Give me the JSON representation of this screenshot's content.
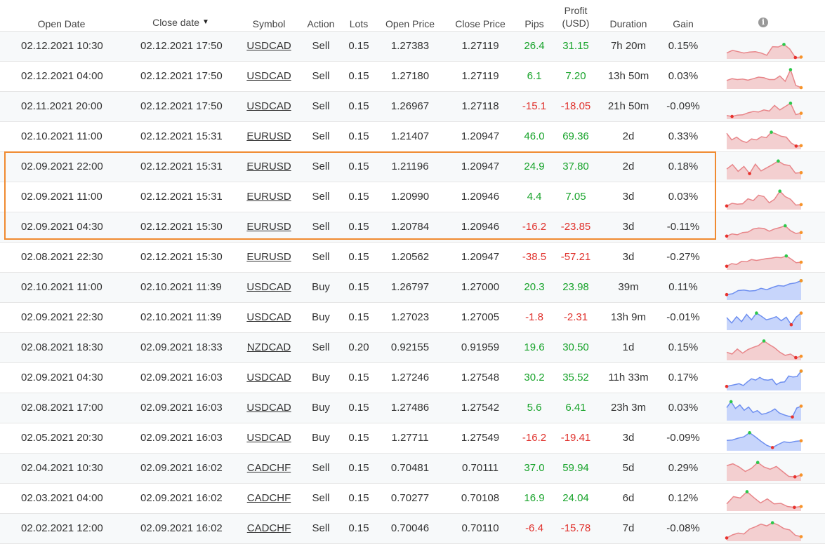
{
  "headers": {
    "open_date": "Open Date",
    "close_date": "Close date",
    "sort_arrow": "▼",
    "symbol": "Symbol",
    "action": "Action",
    "lots": "Lots",
    "open_price": "Open Price",
    "close_price": "Close Price",
    "pips": "Pips",
    "profit_line1": "Profit",
    "profit_line2": "(USD)",
    "duration": "Duration",
    "gain": "Gain",
    "info_glyph": "i"
  },
  "colors": {
    "positive": "#17a32a",
    "negative": "#e0322d",
    "highlight_border": "#f08a30",
    "spark_sell_fill": "#f3cfd0",
    "spark_sell_line": "#e8868a",
    "spark_buy_fill": "#c7d5fb",
    "spark_buy_line": "#6e8ff0",
    "spark_high_dot": "#2cc84a",
    "spark_low_dot": "#e8322d",
    "spark_end_dot": "#f7932a"
  },
  "trades": [
    {
      "open_date": "02.12.2021 10:30",
      "close_date": "02.12.2021 17:50",
      "symbol": "USDCAD",
      "action": "Sell",
      "lots": "0.15",
      "open_price": "1.27383",
      "close_price": "1.27119",
      "pips": "26.4",
      "profit": "31.15",
      "duration": "7h 20m",
      "gain": "0.15%"
    },
    {
      "open_date": "02.12.2021 04:00",
      "close_date": "02.12.2021 17:50",
      "symbol": "USDCAD",
      "action": "Sell",
      "lots": "0.15",
      "open_price": "1.27180",
      "close_price": "1.27119",
      "pips": "6.1",
      "profit": "7.20",
      "duration": "13h 50m",
      "gain": "0.03%"
    },
    {
      "open_date": "02.11.2021 20:00",
      "close_date": "02.12.2021 17:50",
      "symbol": "USDCAD",
      "action": "Sell",
      "lots": "0.15",
      "open_price": "1.26967",
      "close_price": "1.27118",
      "pips": "-15.1",
      "profit": "-18.05",
      "duration": "21h 50m",
      "gain": "-0.09%"
    },
    {
      "open_date": "02.10.2021 11:00",
      "close_date": "02.12.2021 15:31",
      "symbol": "EURUSD",
      "action": "Sell",
      "lots": "0.15",
      "open_price": "1.21407",
      "close_price": "1.20947",
      "pips": "46.0",
      "profit": "69.36",
      "duration": "2d",
      "gain": "0.33%"
    },
    {
      "open_date": "02.09.2021 22:00",
      "close_date": "02.12.2021 15:31",
      "symbol": "EURUSD",
      "action": "Sell",
      "lots": "0.15",
      "open_price": "1.21196",
      "close_price": "1.20947",
      "pips": "24.9",
      "profit": "37.80",
      "duration": "2d",
      "gain": "0.18%"
    },
    {
      "open_date": "02.09.2021 11:00",
      "close_date": "02.12.2021 15:31",
      "symbol": "EURUSD",
      "action": "Sell",
      "lots": "0.15",
      "open_price": "1.20990",
      "close_price": "1.20946",
      "pips": "4.4",
      "profit": "7.05",
      "duration": "3d",
      "gain": "0.03%"
    },
    {
      "open_date": "02.09.2021 04:30",
      "close_date": "02.12.2021 15:30",
      "symbol": "EURUSD",
      "action": "Sell",
      "lots": "0.15",
      "open_price": "1.20784",
      "close_price": "1.20946",
      "pips": "-16.2",
      "profit": "-23.85",
      "duration": "3d",
      "gain": "-0.11%"
    },
    {
      "open_date": "02.08.2021 22:30",
      "close_date": "02.12.2021 15:30",
      "symbol": "EURUSD",
      "action": "Sell",
      "lots": "0.15",
      "open_price": "1.20562",
      "close_price": "1.20947",
      "pips": "-38.5",
      "profit": "-57.21",
      "duration": "3d",
      "gain": "-0.27%"
    },
    {
      "open_date": "02.10.2021 11:00",
      "close_date": "02.10.2021 11:39",
      "symbol": "USDCAD",
      "action": "Buy",
      "lots": "0.15",
      "open_price": "1.26797",
      "close_price": "1.27000",
      "pips": "20.3",
      "profit": "23.98",
      "duration": "39m",
      "gain": "0.11%"
    },
    {
      "open_date": "02.09.2021 22:30",
      "close_date": "02.10.2021 11:39",
      "symbol": "USDCAD",
      "action": "Buy",
      "lots": "0.15",
      "open_price": "1.27023",
      "close_price": "1.27005",
      "pips": "-1.8",
      "profit": "-2.31",
      "duration": "13h 9m",
      "gain": "-0.01%"
    },
    {
      "open_date": "02.08.2021 18:30",
      "close_date": "02.09.2021 18:33",
      "symbol": "NZDCAD",
      "action": "Sell",
      "lots": "0.20",
      "open_price": "0.92155",
      "close_price": "0.91959",
      "pips": "19.6",
      "profit": "30.50",
      "duration": "1d",
      "gain": "0.15%"
    },
    {
      "open_date": "02.09.2021 04:30",
      "close_date": "02.09.2021 16:03",
      "symbol": "USDCAD",
      "action": "Buy",
      "lots": "0.15",
      "open_price": "1.27246",
      "close_price": "1.27548",
      "pips": "30.2",
      "profit": "35.52",
      "duration": "11h 33m",
      "gain": "0.17%"
    },
    {
      "open_date": "02.08.2021 17:00",
      "close_date": "02.09.2021 16:03",
      "symbol": "USDCAD",
      "action": "Buy",
      "lots": "0.15",
      "open_price": "1.27486",
      "close_price": "1.27542",
      "pips": "5.6",
      "profit": "6.41",
      "duration": "23h 3m",
      "gain": "0.03%"
    },
    {
      "open_date": "02.05.2021 20:30",
      "close_date": "02.09.2021 16:03",
      "symbol": "USDCAD",
      "action": "Buy",
      "lots": "0.15",
      "open_price": "1.27711",
      "close_price": "1.27549",
      "pips": "-16.2",
      "profit": "-19.41",
      "duration": "3d",
      "gain": "-0.09%"
    },
    {
      "open_date": "02.04.2021 10:30",
      "close_date": "02.09.2021 16:02",
      "symbol": "CADCHF",
      "action": "Sell",
      "lots": "0.15",
      "open_price": "0.70481",
      "close_price": "0.70111",
      "pips": "37.0",
      "profit": "59.94",
      "duration": "5d",
      "gain": "0.29%"
    },
    {
      "open_date": "02.03.2021 04:00",
      "close_date": "02.09.2021 16:02",
      "symbol": "CADCHF",
      "action": "Sell",
      "lots": "0.15",
      "open_price": "0.70277",
      "close_price": "0.70108",
      "pips": "16.9",
      "profit": "24.04",
      "duration": "6d",
      "gain": "0.12%"
    },
    {
      "open_date": "02.02.2021 12:00",
      "close_date": "02.09.2021 16:02",
      "symbol": "CADCHF",
      "action": "Sell",
      "lots": "0.15",
      "open_price": "0.70046",
      "close_price": "0.70110",
      "pips": "-6.4",
      "profit": "-15.78",
      "duration": "7d",
      "gain": "-0.08%"
    }
  ],
  "sparklines": [
    [
      20,
      32,
      26,
      20,
      24,
      26,
      20,
      10,
      48,
      47,
      58,
      38,
      0,
      2
    ],
    [
      32,
      40,
      36,
      38,
      33,
      40,
      47,
      44,
      36,
      36,
      52,
      28,
      80,
      10,
      0
    ],
    [
      10,
      6,
      12,
      13,
      22,
      28,
      26,
      35,
      30,
      55,
      35,
      50,
      65,
      14,
      20
    ],
    [
      65,
      36,
      48,
      32,
      24,
      40,
      36,
      50,
      46,
      70,
      62,
      52,
      48,
      22,
      8,
      10
    ],
    [
      40,
      60,
      30,
      52,
      20,
      62,
      32,
      46,
      60,
      76,
      60,
      56,
      22,
      24
    ],
    [
      10,
      22,
      18,
      20,
      42,
      34,
      58,
      52,
      24,
      40,
      76,
      52,
      40,
      14,
      16
    ],
    [
      10,
      20,
      16,
      26,
      28,
      42,
      46,
      44,
      32,
      42,
      48,
      56,
      34,
      22,
      26
    ],
    [
      10,
      22,
      18,
      32,
      30,
      40,
      36,
      40,
      44,
      46,
      50,
      48,
      56,
      42,
      26,
      28
    ],
    [
      18,
      22,
      36,
      38,
      34,
      36,
      46,
      40,
      50,
      58,
      56,
      66,
      70,
      80
    ],
    [
      50,
      26,
      54,
      32,
      64,
      40,
      70,
      56,
      40,
      46,
      54,
      36,
      52,
      18,
      52,
      70
    ],
    [
      30,
      22,
      44,
      26,
      42,
      52,
      60,
      80,
      64,
      50,
      30,
      16,
      22,
      6,
      12
    ],
    [
      12,
      16,
      20,
      24,
      16,
      32,
      46,
      40,
      52,
      42,
      40,
      44,
      20,
      30,
      32,
      58,
      54,
      56,
      80
    ],
    [
      52,
      78,
      48,
      64,
      40,
      54,
      30,
      38,
      22,
      26,
      34,
      46,
      28,
      20,
      14,
      10,
      50,
      58
    ],
    [
      40,
      42,
      50,
      56,
      74,
      56,
      36,
      18,
      8,
      22,
      34,
      30,
      36,
      38
    ],
    [
      62,
      70,
      56,
      36,
      50,
      76,
      56,
      46,
      58,
      36,
      14,
      12,
      20
    ],
    [
      26,
      58,
      52,
      80,
      54,
      30,
      48,
      26,
      28,
      14,
      10,
      14
    ],
    [
      8,
      22,
      30,
      26,
      48,
      58,
      70,
      62,
      76,
      66,
      50,
      44,
      20,
      14
    ]
  ]
}
